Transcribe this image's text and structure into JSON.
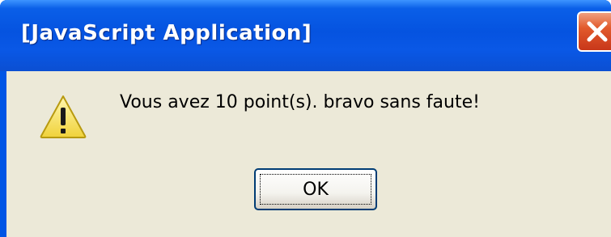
{
  "window": {
    "title": "[JavaScript Application]"
  },
  "titlebar": {
    "close_icon": "close-icon"
  },
  "dialog": {
    "icon": "warning-icon",
    "message": "Vous avez 10 point(s). bravo sans faute!",
    "ok_label": "OK"
  },
  "colors": {
    "titlebar": "#0553e0",
    "client": "#ece9d8",
    "close_button": "#e25a2c",
    "warning_fill": "#f7e36b"
  }
}
